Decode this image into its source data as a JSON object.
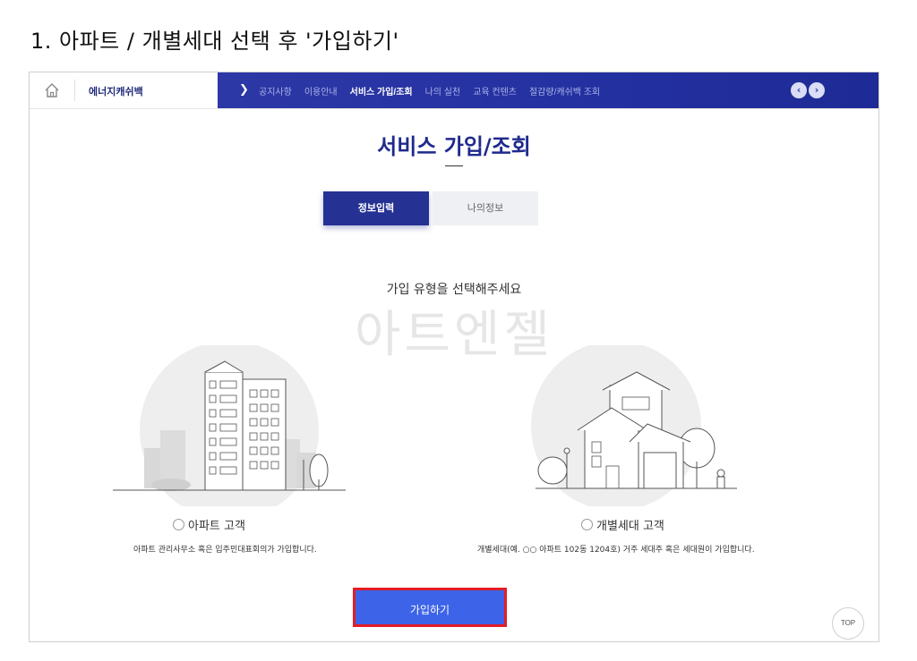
{
  "step_title": "1. 아파트 / 개별세대 선택 후 '가입하기'",
  "header": {
    "brand": "에너지캐쉬백",
    "home_icon": "home-icon",
    "nav_items": [
      {
        "label": "공지사항"
      },
      {
        "label": "이용안내"
      },
      {
        "label": "서비스 가입/조회"
      },
      {
        "label": "나의 실천"
      },
      {
        "label": "교육 컨텐츠"
      },
      {
        "label": "절감량/캐쉬백 조회"
      }
    ],
    "active_nav": "서비스 가입/조회",
    "nav_prev_icon": "chevron-left-icon",
    "nav_next_icon": "chevron-right-icon"
  },
  "page": {
    "title": "서비스 가입/조회",
    "tabs": [
      {
        "label": "정보입력",
        "active": true
      },
      {
        "label": "나의정보",
        "active": false
      }
    ],
    "prompt": "가입 유형을 선택해주세요",
    "watermark": "아트엔젤"
  },
  "options": [
    {
      "label": "아파트 고객",
      "description": "아파트 관리사무소 혹은 입주민대표회의가 가입합니다.",
      "illustration": "apartment-illustration"
    },
    {
      "label": "개별세대 고객",
      "description": "개별세대(예. ○○ 아파트 102동 1204호) 거주 세대주 혹은 세대원이 가입합니다.",
      "illustration": "house-illustration"
    }
  ],
  "actions": {
    "join_label": "가입하기",
    "top_label": "TOP"
  },
  "colors": {
    "nav_bg": "#2330a0",
    "title": "#1f2a8c",
    "tab_active": "#253193",
    "join_button": "#3d63e8",
    "highlight_border": "#e31d26"
  }
}
